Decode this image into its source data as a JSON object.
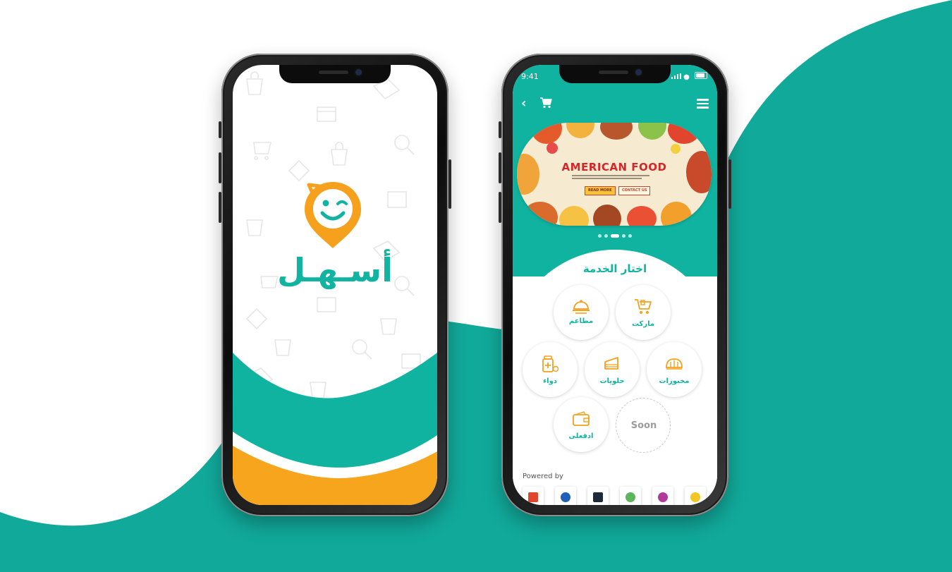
{
  "splash": {
    "brand_name": "أسـهـل"
  },
  "app": {
    "status": {
      "time": "9:41"
    },
    "header": {
      "back_icon": "chevron-left-icon",
      "cart_icon": "cart-icon",
      "menu_icon": "hamburger-menu-icon"
    },
    "banner": {
      "title": "AMERICAN FOOD",
      "read_more": "READ MORE",
      "contact_us": "CONTACT US",
      "slide_count": 5,
      "active_slide": 3
    },
    "services_title": "اختار الخدمة",
    "services": [
      {
        "label": "ماركت",
        "icon": "grocery-cart-icon"
      },
      {
        "label": "مطاعم",
        "icon": "food-tray-icon"
      },
      {
        "label": "مخبوزات",
        "icon": "bread-icon"
      },
      {
        "label": "حلويات",
        "icon": "cake-slice-icon"
      },
      {
        "label": "دواء",
        "icon": "medicine-bottle-icon"
      },
      {
        "label": "ادفعلى",
        "icon": "wallet-icon"
      },
      {
        "label": "Soon",
        "icon": ""
      }
    ],
    "powered_by": "Powered by"
  },
  "colors": {
    "teal": "#11b3a1",
    "orange": "#f5a623",
    "white": "#ffffff"
  }
}
